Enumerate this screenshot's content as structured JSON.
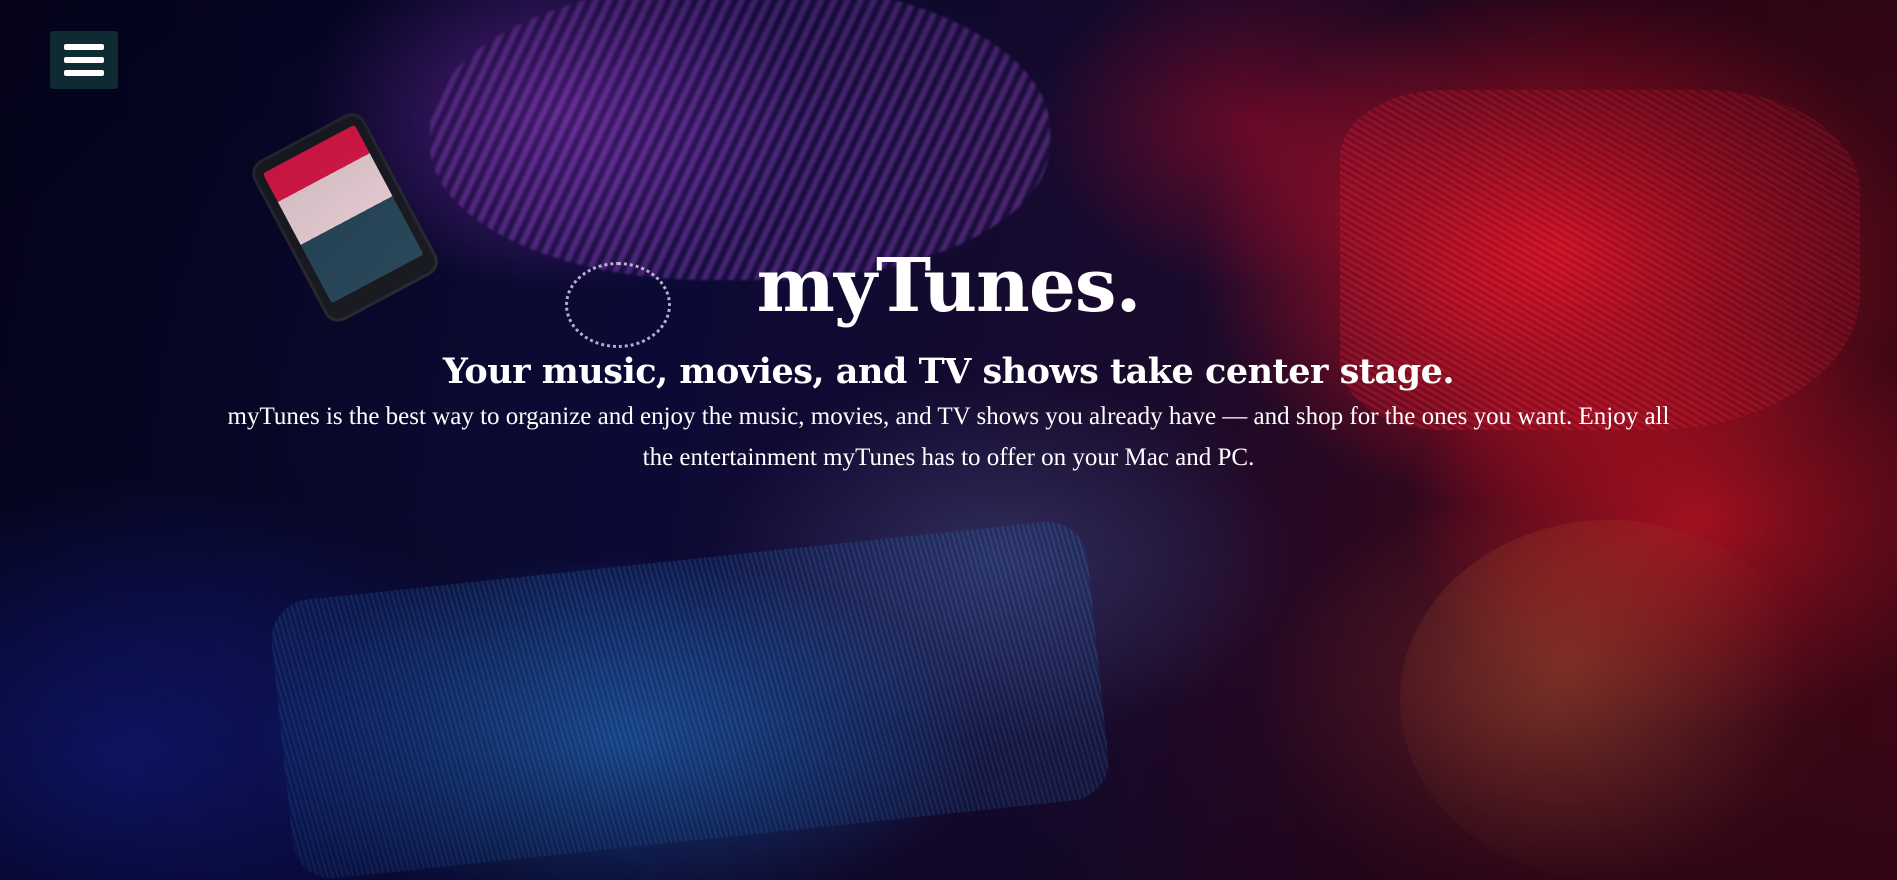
{
  "menu": {
    "icon": "hamburger-menu-icon"
  },
  "hero": {
    "title": "myTunes.",
    "subtitle": "Your music, movies, and TV shows take center stage.",
    "description": "myTunes is the best way to organize and enjoy the music, movies, and TV shows you already have — and shop for the ones you want. Enjoy all the entertainment myTunes has to offer on your Mac and PC."
  },
  "colors": {
    "text": "#ffffff",
    "menu_background": "#0e2a32",
    "accent_red": "#e0142a",
    "accent_blue": "#1e3caa"
  }
}
